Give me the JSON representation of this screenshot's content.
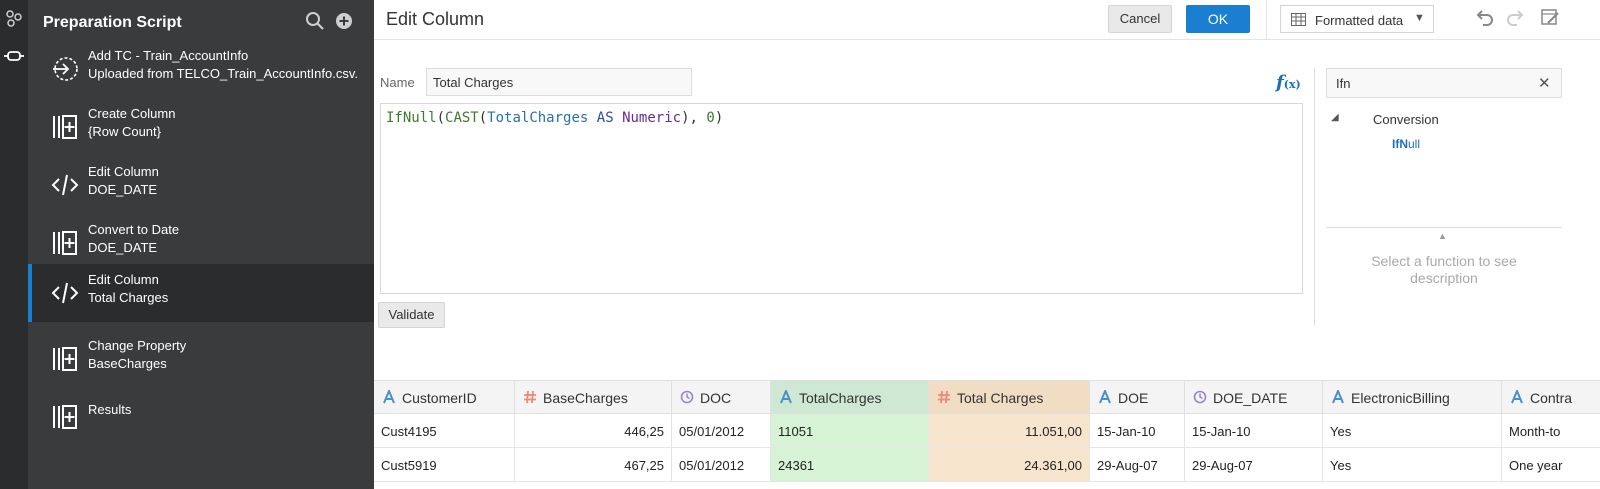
{
  "sidebar": {
    "title": "Preparation Script",
    "steps": [
      {
        "line1": "Add TC - Train_AccountInfo",
        "line2": "Uploaded from TELCO_Train_AccountInfo.csv.",
        "icon": "import-arrow-icon"
      },
      {
        "line1": "Create Column",
        "line2": "{Row Count}",
        "icon": "add-column-icon"
      },
      {
        "line1": "Edit Column",
        "line2": "DOE_DATE",
        "icon": "code-icon"
      },
      {
        "line1": "Convert to Date",
        "line2": "DOE_DATE",
        "icon": "add-column-icon"
      },
      {
        "line1": "Edit Column",
        "line2": "Total Charges",
        "icon": "code-icon"
      },
      {
        "line1": "Change Property",
        "line2": "BaseCharges",
        "icon": "add-column-icon"
      },
      {
        "line1": "Results",
        "line2": "",
        "icon": "add-column-icon"
      }
    ]
  },
  "header": {
    "title": "Edit Column",
    "cancel_label": "Cancel",
    "ok_label": "OK",
    "view_dropdown": "Formatted data"
  },
  "editor": {
    "name_label": "Name",
    "name_value": "Total Charges",
    "expression_tokens": [
      {
        "t": "IfNull",
        "c": "fn"
      },
      {
        "t": "(",
        "c": "pl"
      },
      {
        "t": "CAST",
        "c": "fn"
      },
      {
        "t": "(",
        "c": "pl"
      },
      {
        "t": "TotalCharges",
        "c": "col"
      },
      {
        "t": " ",
        "c": "pl"
      },
      {
        "t": "AS",
        "c": "kw"
      },
      {
        "t": " ",
        "c": "pl"
      },
      {
        "t": "Numeric",
        "c": "type"
      },
      {
        "t": "), ",
        "c": "pl"
      },
      {
        "t": "0",
        "c": "fn"
      },
      {
        "t": ")",
        "c": "pl"
      }
    ],
    "validate_label": "Validate"
  },
  "functions": {
    "search_value": "Ifn",
    "category": "Conversion",
    "item_match": "IfN",
    "item_rest": "ull",
    "description": "Select a function to see description"
  },
  "grid": {
    "columns": [
      {
        "name": "CustomerID",
        "type": "text"
      },
      {
        "name": "BaseCharges",
        "type": "number"
      },
      {
        "name": "DOC",
        "type": "date"
      },
      {
        "name": "TotalCharges",
        "type": "text"
      },
      {
        "name": "Total Charges",
        "type": "number"
      },
      {
        "name": "DOE",
        "type": "text"
      },
      {
        "name": "DOE_DATE",
        "type": "date"
      },
      {
        "name": "ElectronicBilling",
        "type": "text"
      },
      {
        "name": "Contra",
        "type": "text"
      }
    ],
    "rows": [
      [
        "Cust4195",
        "446,25",
        "05/01/2012",
        "11051",
        "11.051,00",
        "15-Jan-10",
        "15-Jan-10",
        "Yes",
        "Month-to"
      ],
      [
        "Cust5919",
        "467,25",
        "05/01/2012",
        "24361",
        "24.361,00",
        "29-Aug-07",
        "29-Aug-07",
        "Yes",
        "One year"
      ]
    ]
  },
  "colors": {
    "accent": "#1a7fd0",
    "sidebar_bg": "#3a3b3d",
    "source_column_bg": "#d6f3d6",
    "result_column_bg": "#f7e4cc"
  }
}
